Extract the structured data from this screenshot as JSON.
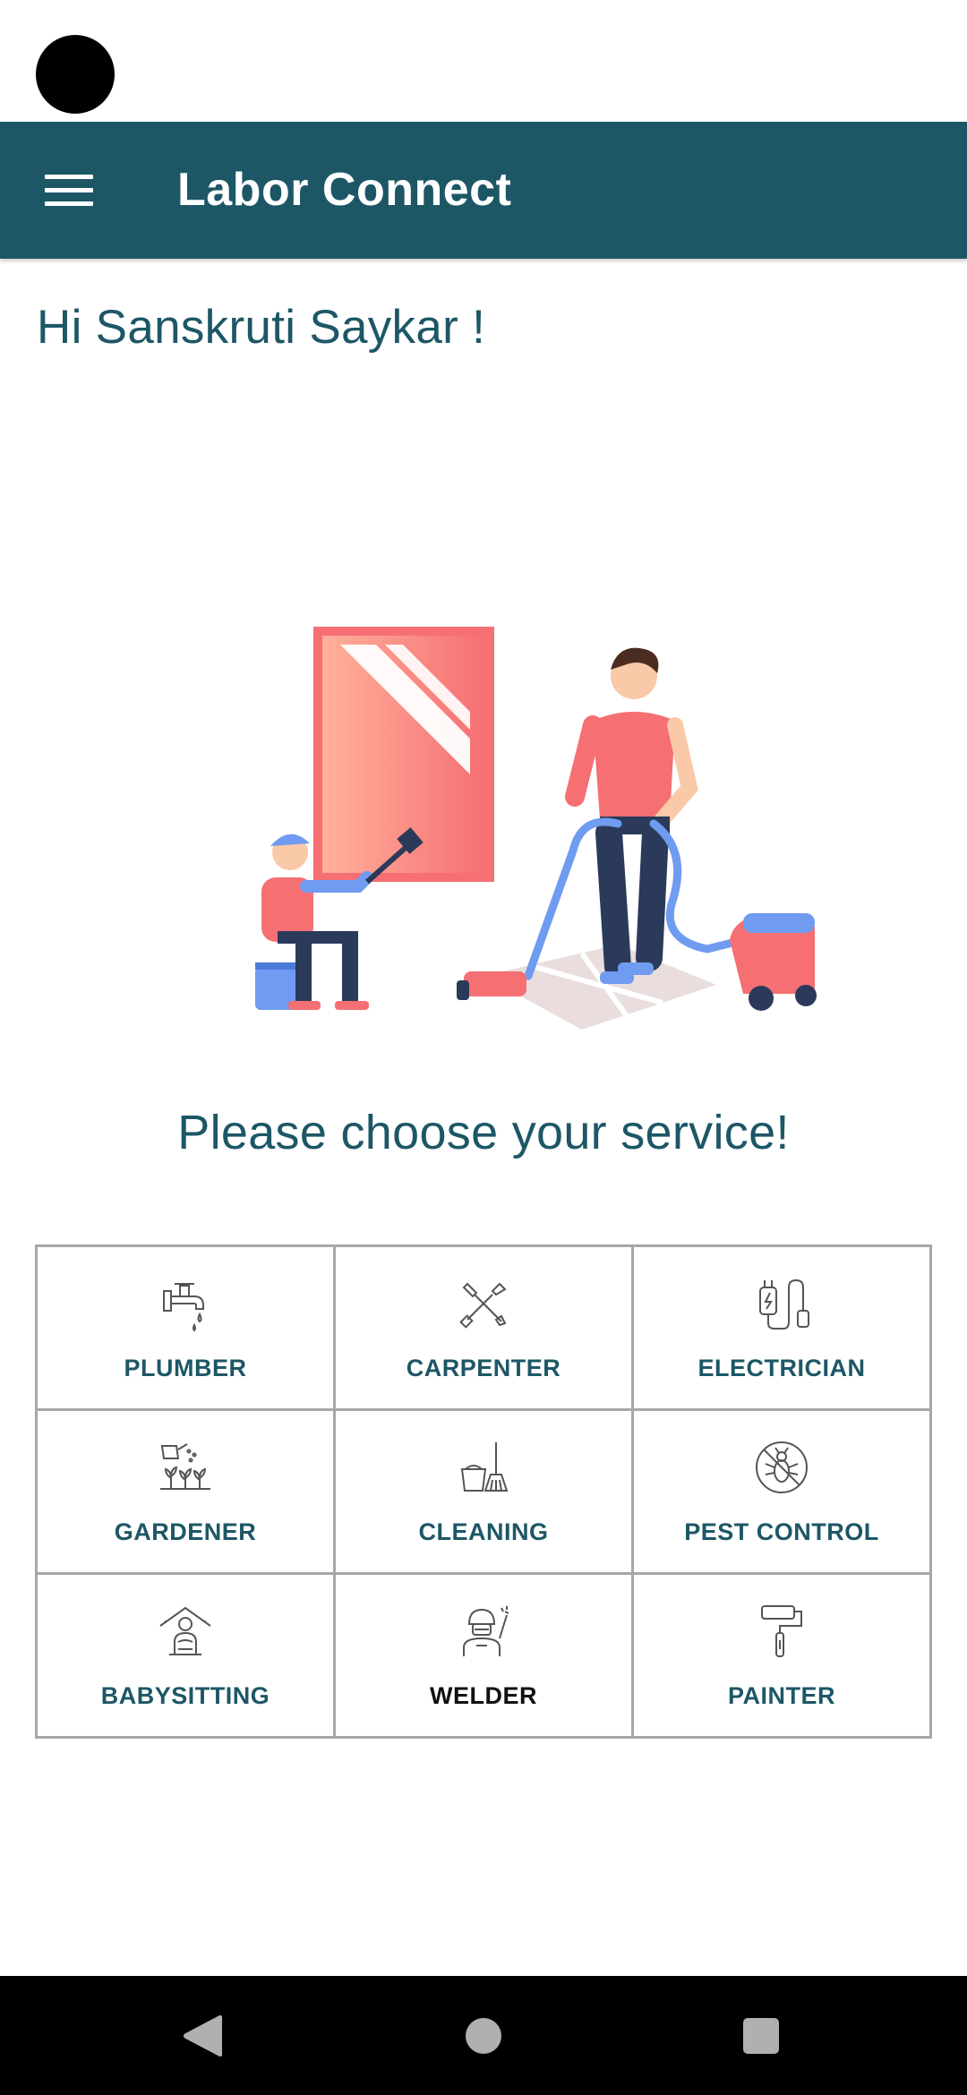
{
  "app": {
    "title": "Labor Connect",
    "accent_color": "#1d5766"
  },
  "greeting": "Hi Sanskruti Saykar !",
  "prompt": "Please choose your service!",
  "services": [
    {
      "label": "PLUMBER",
      "icon": "faucet-icon"
    },
    {
      "label": "CARPENTER",
      "icon": "tools-icon"
    },
    {
      "label": "ELECTRICIAN",
      "icon": "electric-plug-icon"
    },
    {
      "label": "GARDENER",
      "icon": "watering-can-icon"
    },
    {
      "label": "CLEANING",
      "icon": "bucket-broom-icon"
    },
    {
      "label": "PEST CONTROL",
      "icon": "no-bug-icon"
    },
    {
      "label": "BABYSITTING",
      "icon": "house-child-icon"
    },
    {
      "label": "WELDER",
      "icon": "welder-icon"
    },
    {
      "label": "PAINTER",
      "icon": "paint-roller-icon"
    }
  ],
  "nav": {
    "back_icon": "back-triangle-icon",
    "home_icon": "home-circle-icon",
    "recents_icon": "recents-square-icon"
  }
}
